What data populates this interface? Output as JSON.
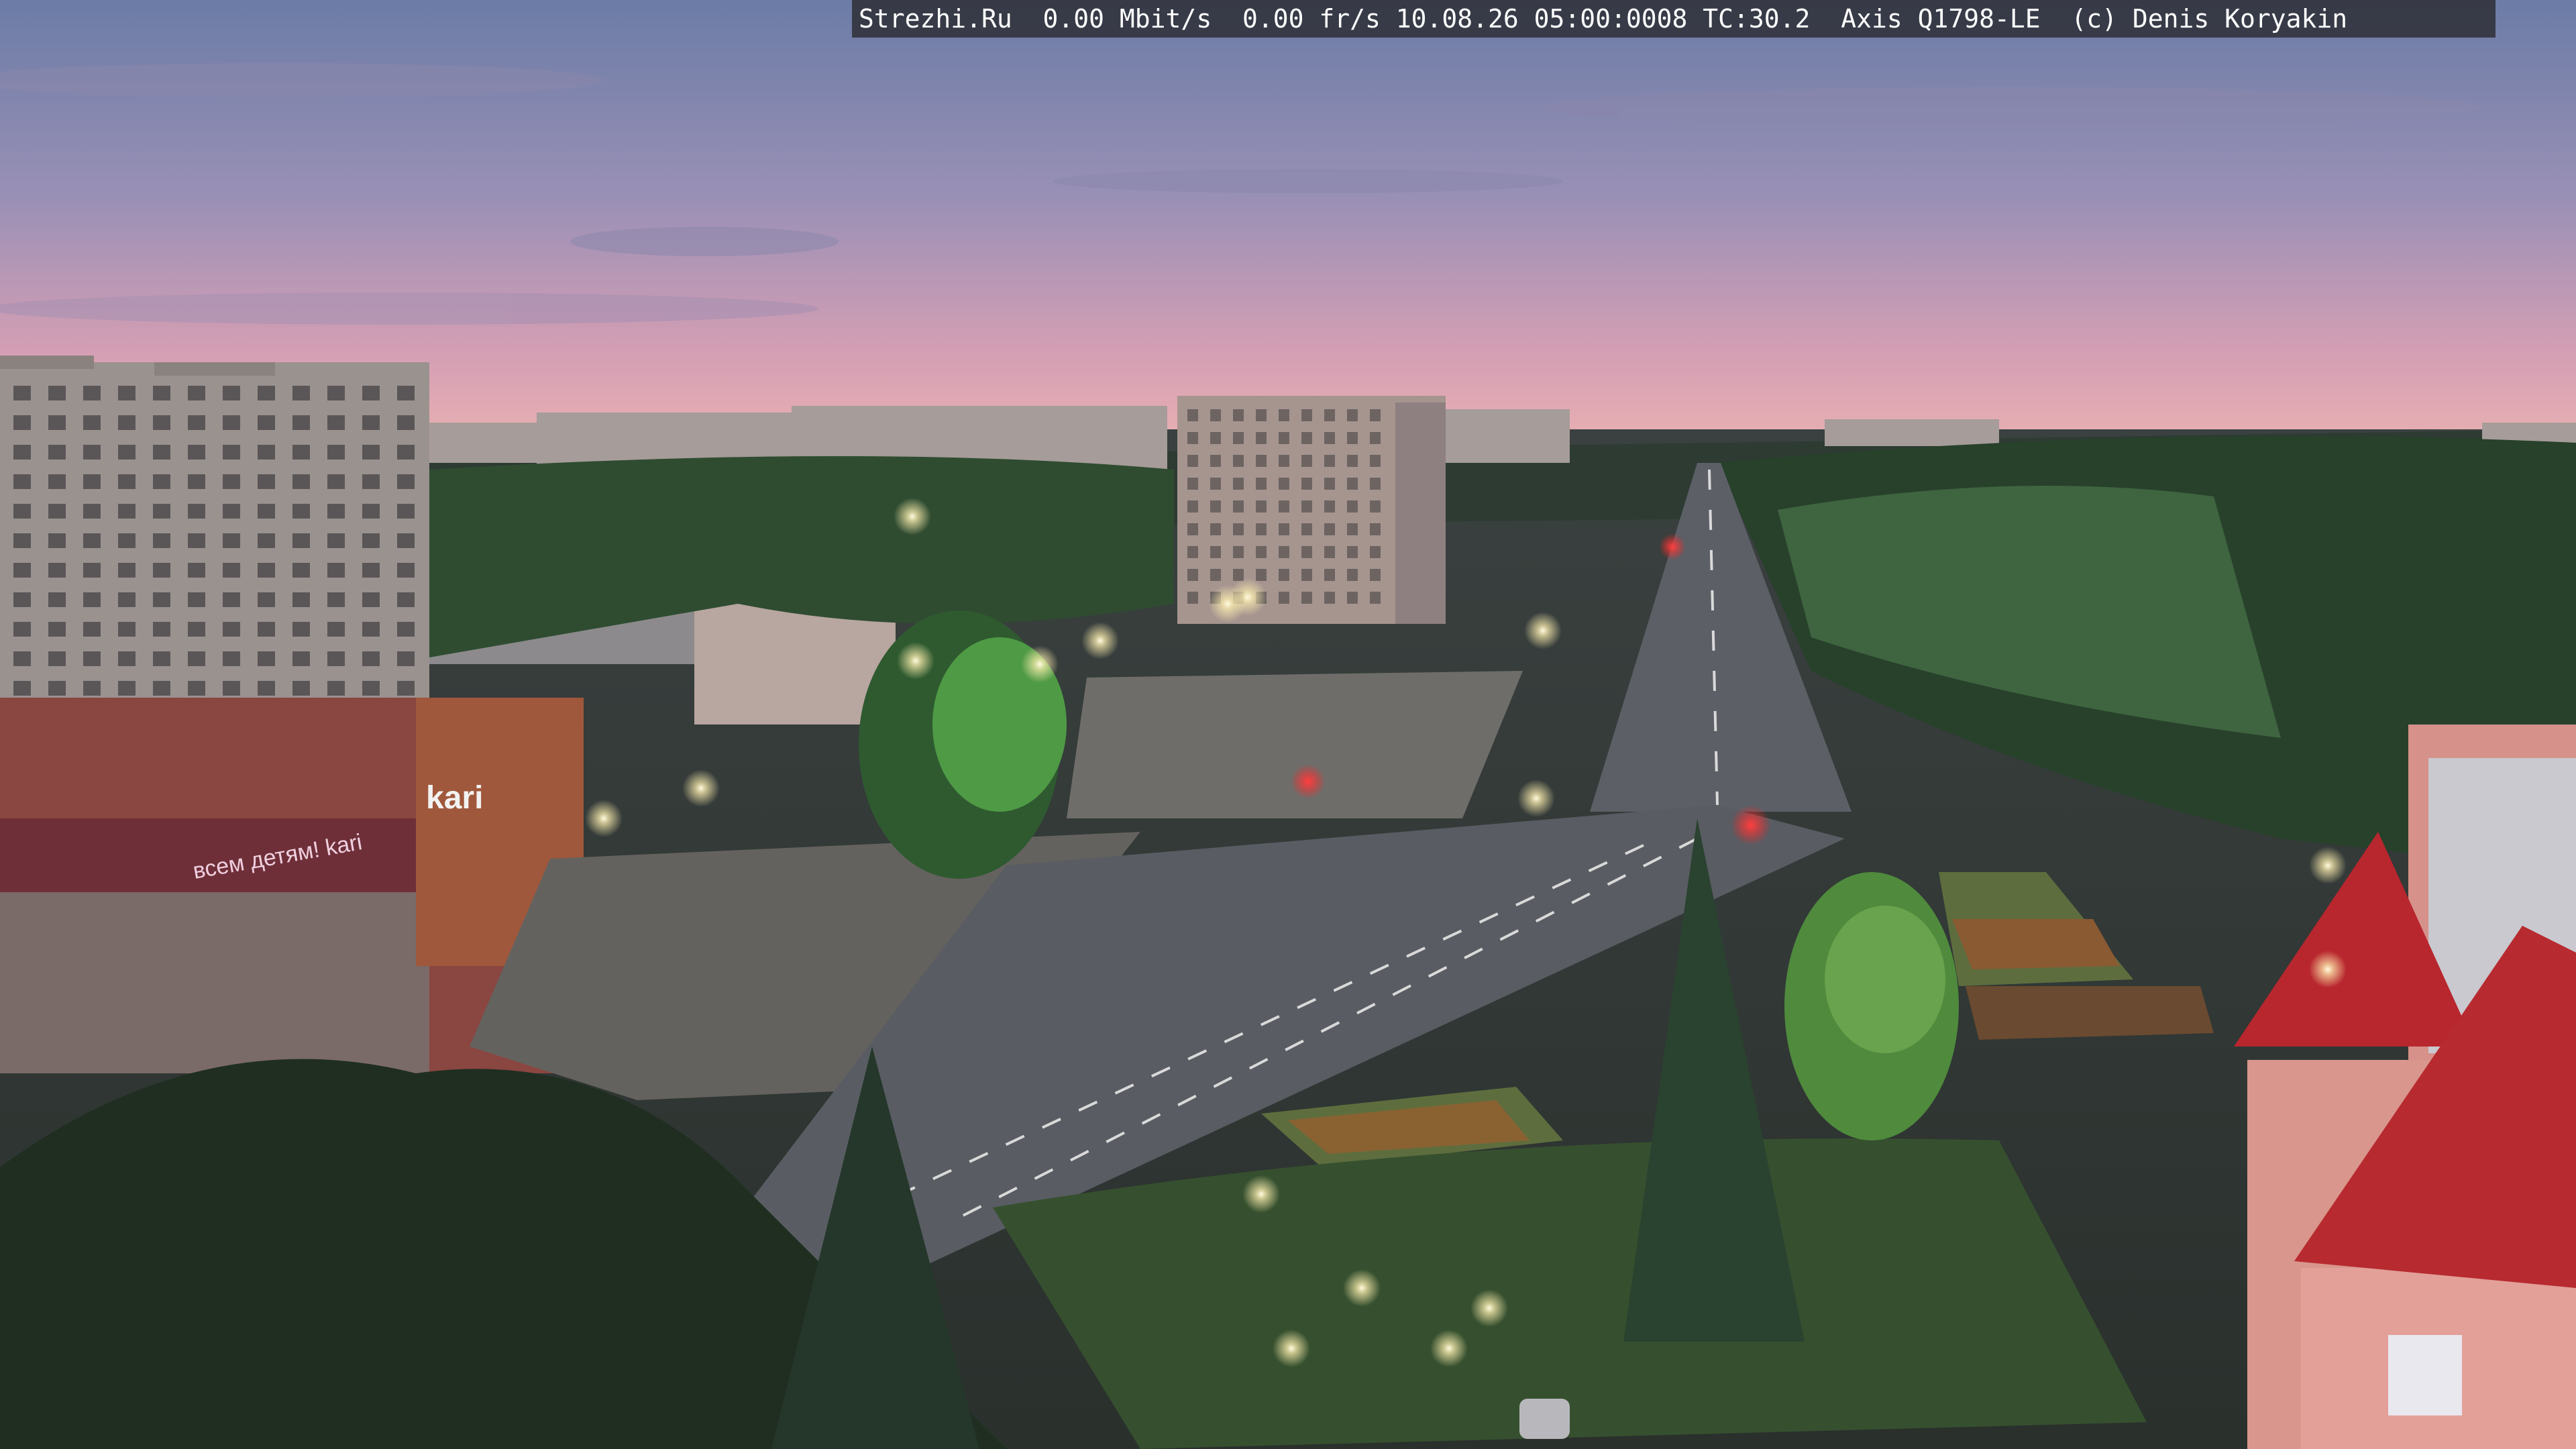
{
  "overlay": {
    "text": "Strezhi.Ru  0.00 Mbit/s  0.00 fr/s 10.08.26 05:00:0008 TC:30.2  Axis Q1798-LE  (c) Denis Koryakin"
  },
  "signs": {
    "store_brand": "kari",
    "store_brand_2": "kari",
    "store_slogan": "всем детям! kari"
  },
  "colors": {
    "sky_top": "#6f7fa8",
    "sky_mid": "#a895b8",
    "sky_horizon": "#e7a5b5",
    "trees": "#2e4a30",
    "road": "#5a5d63",
    "pink_building": "#d9908a",
    "red_roof": "#b8262e",
    "street_light": "#fff6d0"
  }
}
